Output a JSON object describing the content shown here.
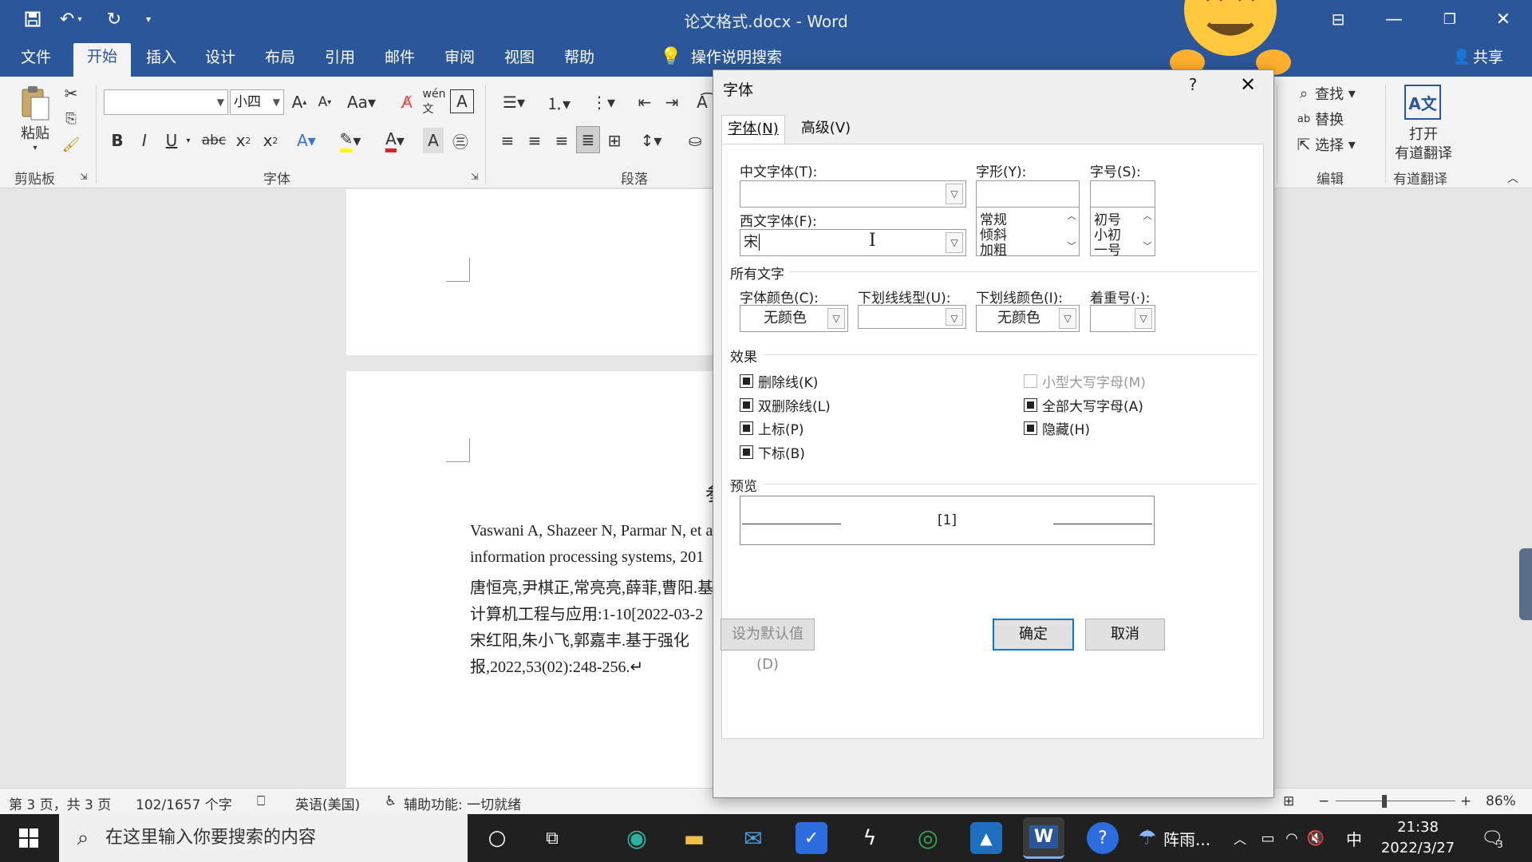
{
  "window": {
    "title": "论文格式.docx  -  Word"
  },
  "titlebar": {
    "save_icon": "save-icon",
    "undo_icon": "undo-icon",
    "redo_icon": "redo-icon"
  },
  "ribbon_tabs": [
    "文件",
    "开始",
    "插入",
    "设计",
    "布局",
    "引用",
    "邮件",
    "审阅",
    "视图",
    "帮助"
  ],
  "tell_me": "操作说明搜索",
  "share": "共享",
  "ribbon": {
    "paste": "粘贴",
    "font_name": "",
    "font_size": "小四",
    "groups": {
      "clipboard": "剪贴板",
      "font": "字体",
      "paragraph": "段落",
      "editing": "编辑",
      "youdao": "有道翻译"
    },
    "find": "查找",
    "replace": "替换",
    "select": "选择",
    "open_translate": "打开",
    "youdao_translate": "有道翻译"
  },
  "document": {
    "heading_fragment": "参",
    "references": [
      "Vaswani A, Shazeer N, Parmar N, et a",
      "information processing systems, 201",
      "唐恒亮,尹棋正,常亮亮,薛菲,曹阳.基",
      "计算机工程与应用:1-10[2022-03-2",
      "宋红阳,朱小飞,郭嘉丰.基于强化",
      "报,2022,53(02):248-256.↵"
    ]
  },
  "status": {
    "page": "第 3 页，共 3 页",
    "words": "102/1657 个字",
    "language": "英语(美国)",
    "accessibility": "辅助功能: 一切就绪",
    "zoom": "86%"
  },
  "taskbar": {
    "search_placeholder": "在这里输入你要搜索的内容",
    "weather": "阵雨...",
    "ime": "中",
    "time": "21:38",
    "date": "2022/3/27",
    "notifications": "3"
  },
  "dialog": {
    "title": "字体",
    "help": "?",
    "tabs": [
      "字体(N)",
      "高级(V)"
    ],
    "chinese_font_label": "中文字体(T):",
    "chinese_font_value": "",
    "western_font_label": "西文字体(F):",
    "western_font_value": "宋",
    "style_label": "字形(Y):",
    "style_value": "",
    "style_options": [
      "常规",
      "倾斜",
      "加粗"
    ],
    "size_label": "字号(S):",
    "size_value": "",
    "size_options": [
      "初号",
      "小初",
      "一号"
    ],
    "all_text": "所有文字",
    "font_color_label": "字体颜色(C):",
    "font_color_value": "无颜色",
    "underline_style_label": "下划线线型(U):",
    "underline_style_value": "",
    "underline_color_label": "下划线颜色(I):",
    "underline_color_value": "无颜色",
    "emphasis_label": "着重号(·):",
    "emphasis_value": "",
    "effects": "效果",
    "checkboxes": {
      "strikethrough": "删除线(K)",
      "double_strike": "双删除线(L)",
      "superscript": "上标(P)",
      "subscript": "下标(B)",
      "small_caps": "小型大写字母(M)",
      "all_caps": "全部大写字母(A)",
      "hidden": "隐藏(H)"
    },
    "preview": "预览",
    "preview_text": "[1]",
    "set_default": "设为默认值(D)",
    "ok": "确定",
    "cancel": "取消"
  },
  "colors": {
    "word_blue": "#2b579a",
    "ribbon_bg": "#f3f3f3",
    "taskbar": "#202020",
    "ok_border": "#0078d7"
  }
}
